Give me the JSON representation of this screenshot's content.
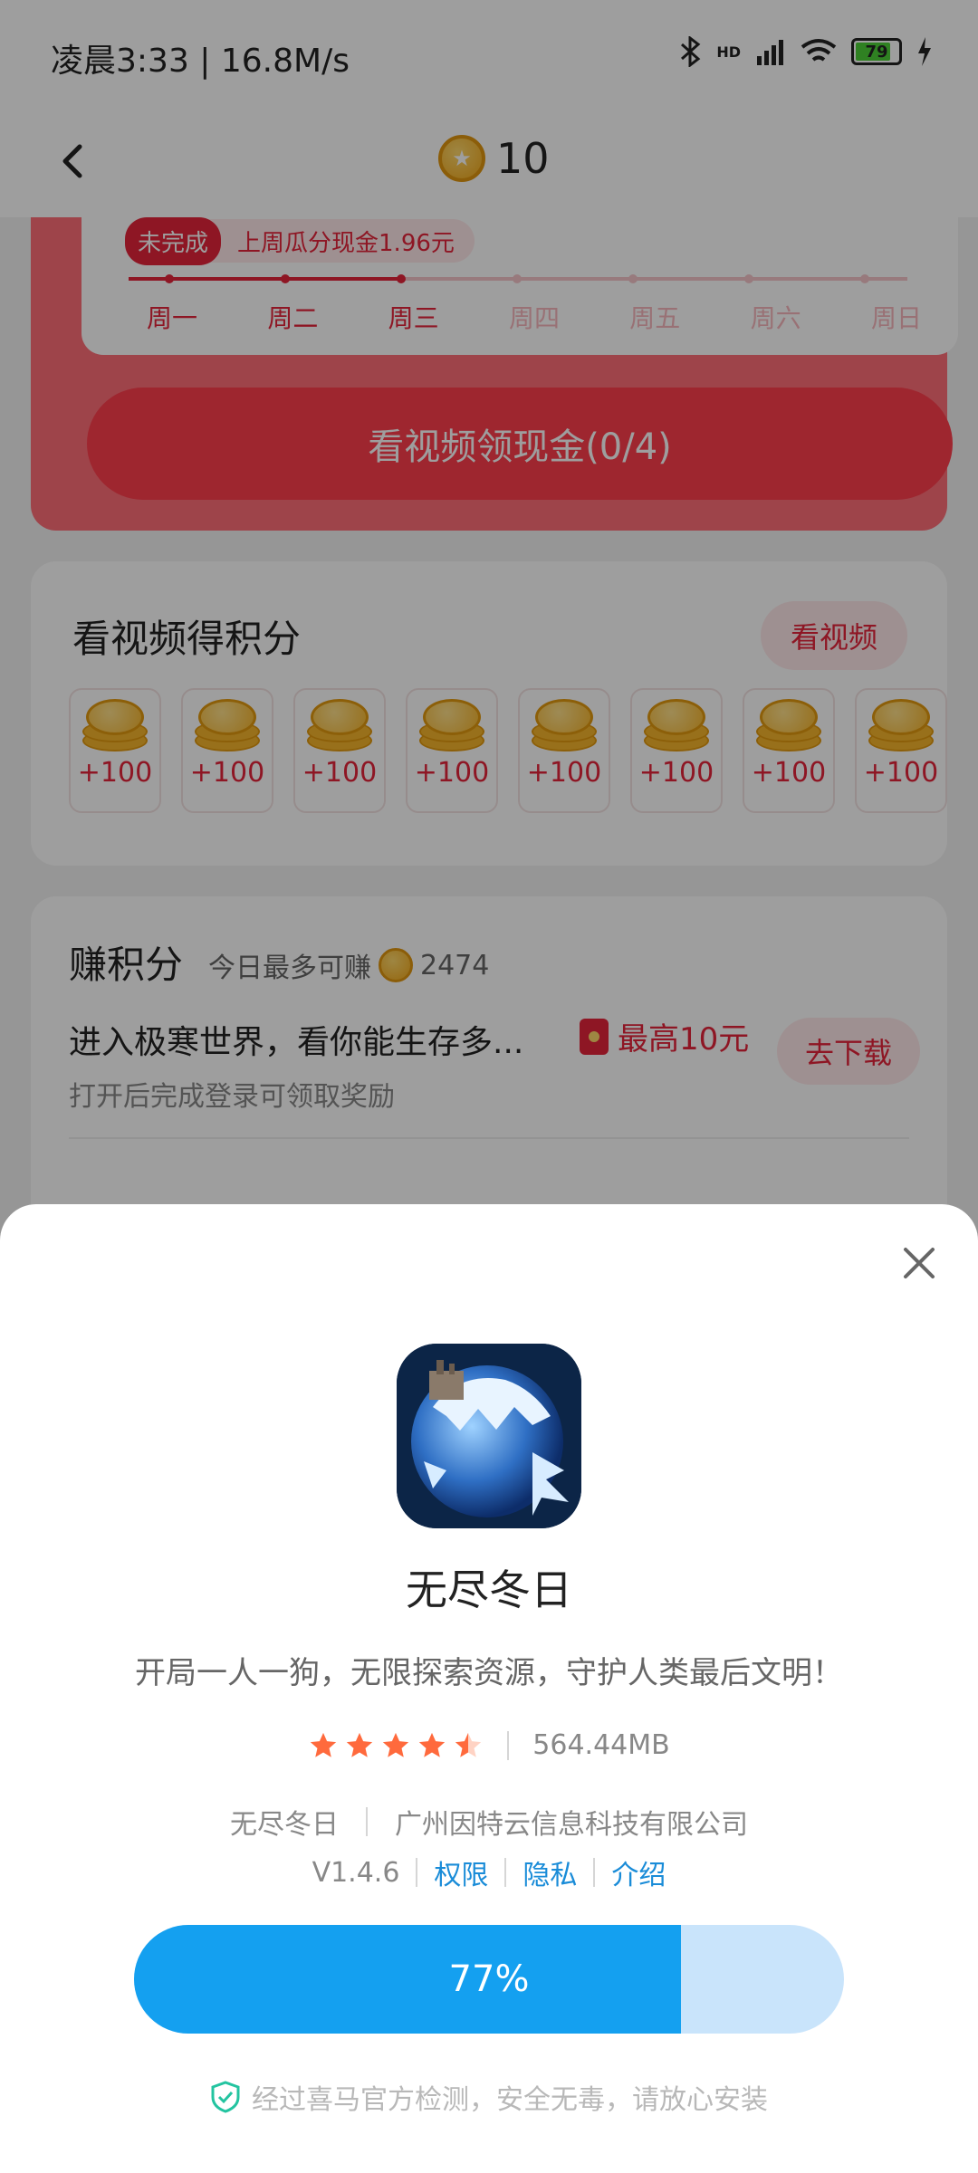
{
  "status_bar": {
    "time_speed": "凌晨3:33 | 16.8M/s",
    "network_badge": "HD",
    "battery": "79",
    "icons": [
      "bluetooth-icon",
      "signal-icon",
      "wifi-icon",
      "battery-icon",
      "charging-icon"
    ]
  },
  "header": {
    "coin_count": "10"
  },
  "signin": {
    "status_tag": "未完成",
    "status_text": "上周瓜分现金1.96元",
    "days": [
      "周一",
      "周二",
      "周三",
      "周四",
      "周五",
      "周六",
      "周日"
    ],
    "completed_days": 3,
    "button": "看视频领现金(0/4)"
  },
  "video_card": {
    "title": "看视频得积分",
    "button": "看视频",
    "rewards": [
      "+100",
      "+100",
      "+100",
      "+100",
      "+100",
      "+100",
      "+100",
      "+100"
    ]
  },
  "earn_card": {
    "title": "赚积分",
    "subtitle": "今日最多可赚",
    "max_points": "2474",
    "task": {
      "title": "进入极寒世界，看你能生存多...",
      "reward": "最高10元",
      "desc": "打开后完成登录可领取奖励",
      "button": "去下载"
    }
  },
  "sheet": {
    "app_name": "无尽冬日",
    "description": "开局一人一狗，无限探索资源，守护人类最后文明！",
    "rating": 4.5,
    "size": "564.44MB",
    "developer_app": "无尽冬日",
    "company": "广州因特云信息科技有限公司",
    "version": "V1.4.6",
    "link_permissions": "权限",
    "link_privacy": "隐私",
    "link_intro": "介绍",
    "download_progress": 77,
    "progress_label": "77%",
    "safe_text": "经过喜马官方检测，安全无毒，请放心安装"
  },
  "colors": {
    "accent_red": "#e6253b",
    "progress_blue": "#14a0f0",
    "link_blue": "#1a8cd8"
  }
}
